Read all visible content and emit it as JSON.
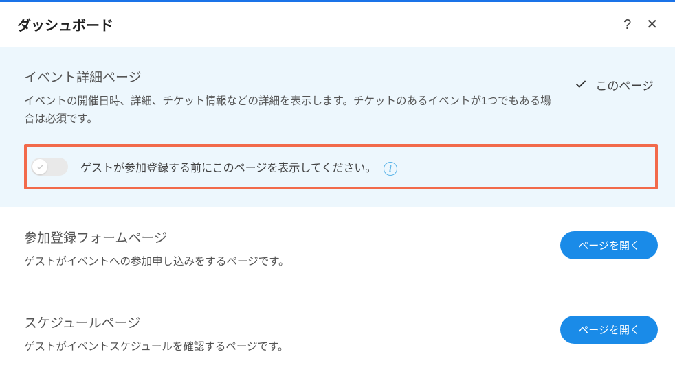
{
  "header": {
    "title": "ダッシュボード"
  },
  "sections": {
    "event_detail": {
      "title": "イベント詳細ページ",
      "desc": "イベントの開催日時、詳細、チケット情報などの詳細を表示します。チケットのあるイベントが1つでもある場合は必須です。",
      "this_page_label": "このページ",
      "toggle_label": "ゲストが参加登録する前にこのページを表示してください。"
    },
    "registration": {
      "title": "参加登録フォームページ",
      "desc": "ゲストがイベントへの参加申し込みをするページです。",
      "button": "ページを開く"
    },
    "schedule": {
      "title": "スケジュールページ",
      "desc": "ゲストがイベントスケジュールを確認するページです。",
      "button": "ページを開く"
    }
  },
  "info_glyph": "i"
}
